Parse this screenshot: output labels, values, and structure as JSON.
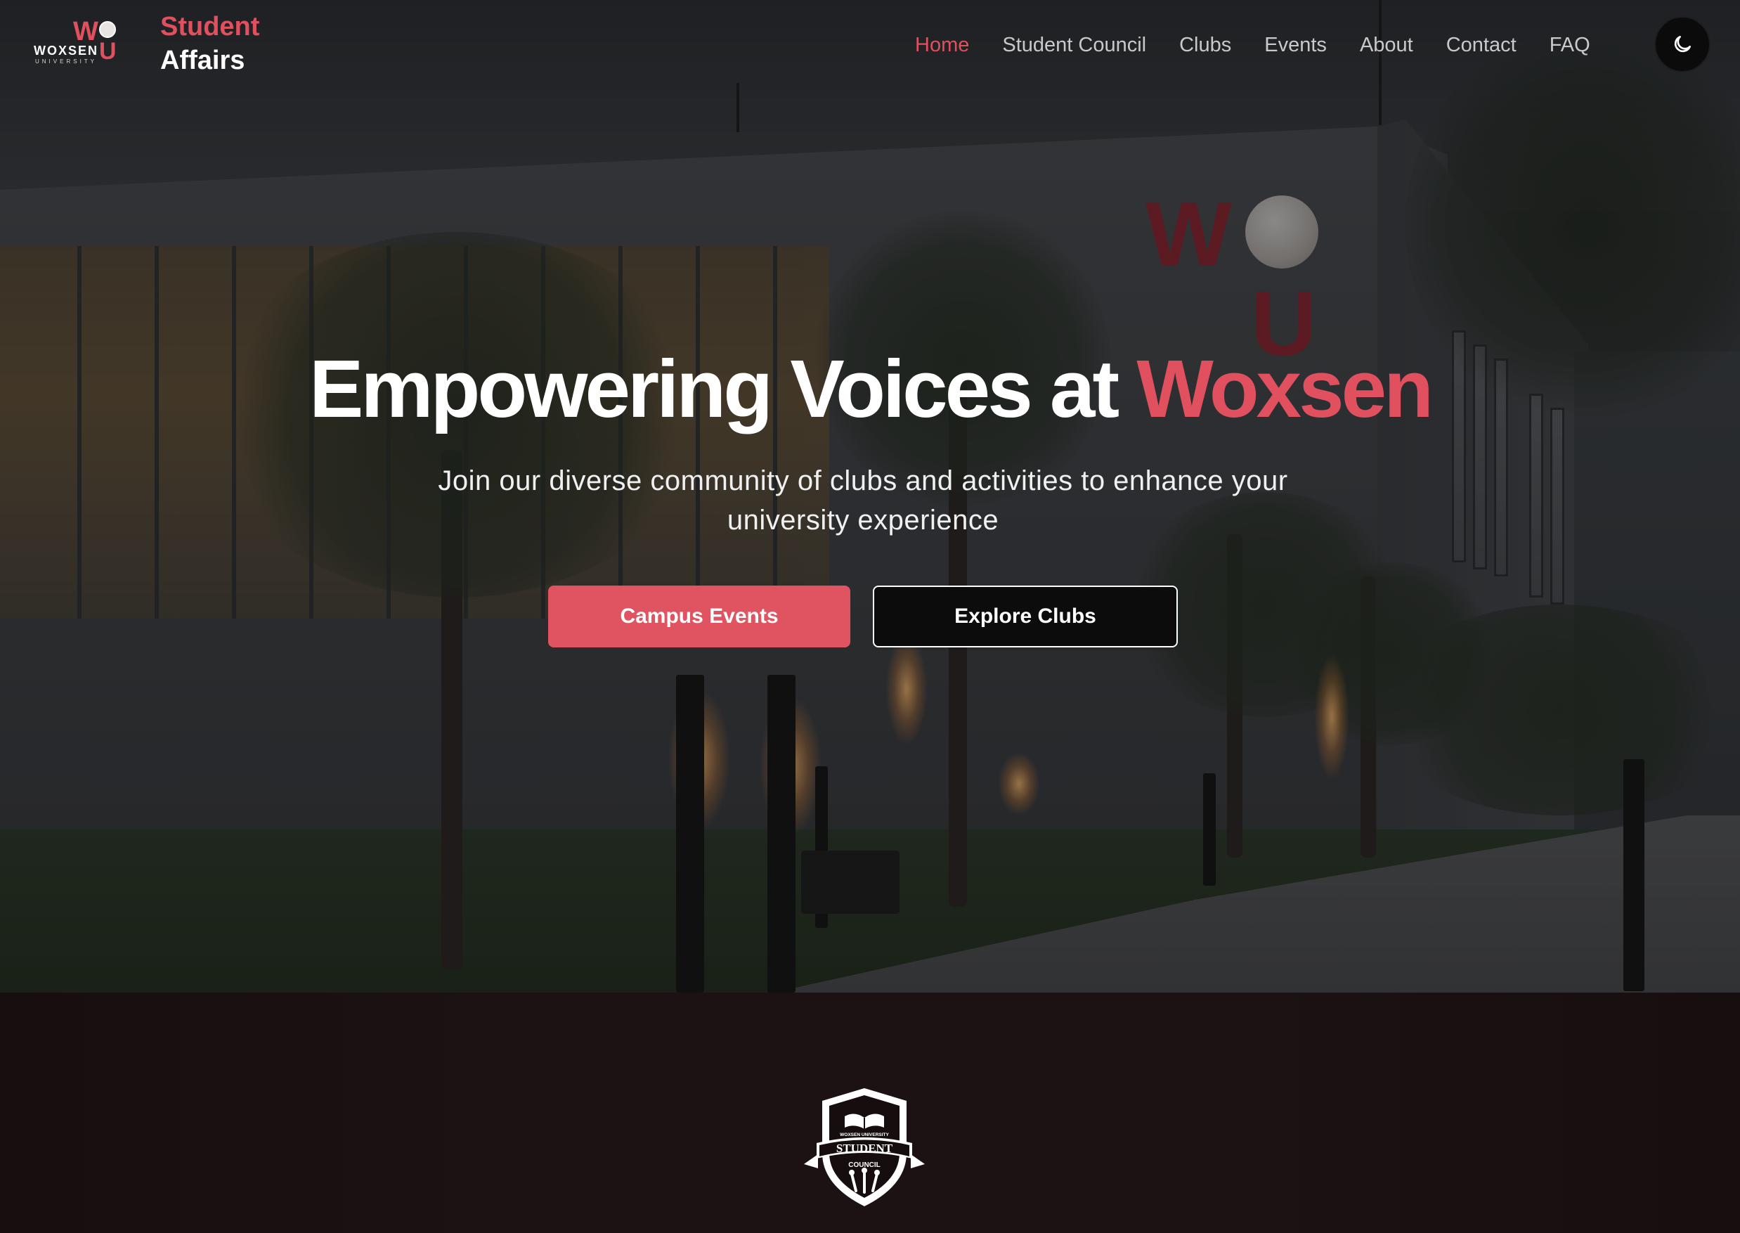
{
  "brand": {
    "logo_letters_top": "W",
    "logo_letters_bottom": "U",
    "logo_name": "WOXSEN",
    "logo_sub": "UNIVERSITY",
    "title_line1": "Student",
    "title_line2": "Affairs"
  },
  "nav": {
    "items": [
      {
        "label": "Home",
        "active": true
      },
      {
        "label": "Student Council",
        "active": false
      },
      {
        "label": "Clubs",
        "active": false
      },
      {
        "label": "Events",
        "active": false
      },
      {
        "label": "About",
        "active": false
      },
      {
        "label": "Contact",
        "active": false
      },
      {
        "label": "FAQ",
        "active": false
      }
    ],
    "theme_toggle_icon": "moon-icon"
  },
  "hero": {
    "headline_main": "Empowering Voices at ",
    "headline_accent": "Woxsen",
    "subtext": "Join our diverse community of clubs and activities to enhance your university experience",
    "primary_button": "Campus Events",
    "secondary_button": "Explore Clubs",
    "background_sign_top": "W",
    "background_sign_bottom": "U"
  },
  "crest": {
    "top_text": "WOXSEN UNIVERSITY",
    "banner_text": "STUDENT",
    "sub_text": "COUNCIL"
  },
  "colors": {
    "accent": "#e0505e",
    "button_primary": "#df5460",
    "lower_background": "#1c1214",
    "nav_text": "#c9c9cb"
  }
}
